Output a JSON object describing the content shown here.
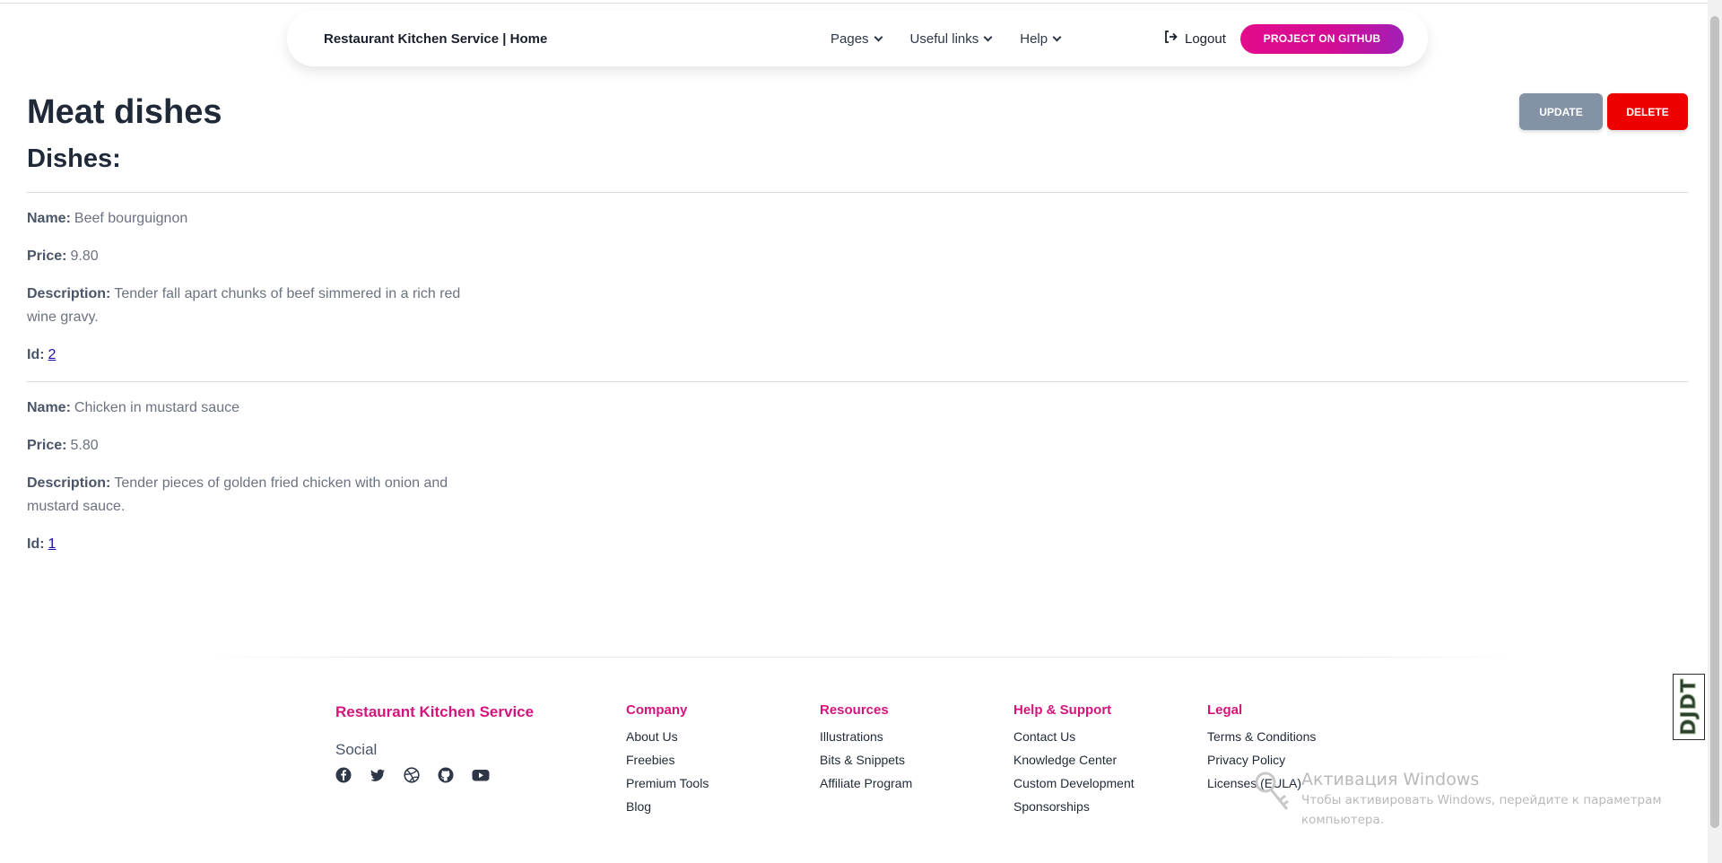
{
  "nav": {
    "brand": "Restaurant Kitchen Service | Home",
    "menu": [
      {
        "label": "Pages"
      },
      {
        "label": "Useful links"
      },
      {
        "label": "Help"
      }
    ],
    "logout_label": "Logout",
    "github_label": "PROJECT ON GITHUB"
  },
  "page": {
    "title": "Meat dishes",
    "section_title": "Dishes:",
    "update_label": "UPDATE",
    "delete_label": "DELETE"
  },
  "dishes": [
    {
      "name_label": "Name:",
      "name": "Beef bourguignon",
      "price_label": "Price:",
      "price": "9.80",
      "description_label": "Description:",
      "description": "Tender fall apart chunks of beef simmered in a rich red wine gravy.",
      "id_label": "Id:",
      "id": "2"
    },
    {
      "name_label": "Name:",
      "name": "Chicken in mustard sauce",
      "price_label": "Price:",
      "price": "5.80",
      "description_label": "Description:",
      "description": "Tender pieces of golden fried chicken with onion and mustard sauce.",
      "id_label": "Id:",
      "id": "1"
    }
  ],
  "footer": {
    "brand": "Restaurant Kitchen Service",
    "social_label": "Social",
    "social_icons": [
      "facebook-icon",
      "twitter-icon",
      "dribbble-icon",
      "github-icon",
      "youtube-icon"
    ],
    "columns": [
      {
        "title": "Company",
        "links": [
          "About Us",
          "Freebies",
          "Premium Tools",
          "Blog"
        ]
      },
      {
        "title": "Resources",
        "links": [
          "Illustrations",
          "Bits & Snippets",
          "Affiliate Program"
        ]
      },
      {
        "title": "Help & Support",
        "links": [
          "Contact Us",
          "Knowledge Center",
          "Custom Development",
          "Sponsorships"
        ]
      },
      {
        "title": "Legal",
        "links": [
          "Terms & Conditions",
          "Privacy Policy",
          "Licenses (EULA)"
        ]
      }
    ]
  },
  "debug_toolbar": {
    "label": "DJDT"
  },
  "windows_watermark": {
    "title": "Активация Windows",
    "line1": "Чтобы активировать Windows, перейдите к параметрам",
    "line2": "компьютера."
  },
  "colors": {
    "accent_pink": "#d4147d",
    "update_gray": "#8492a6",
    "delete_red": "#ee0000",
    "github_gradient_start": "#e30b8b",
    "github_gradient_end": "#a11fb5"
  }
}
